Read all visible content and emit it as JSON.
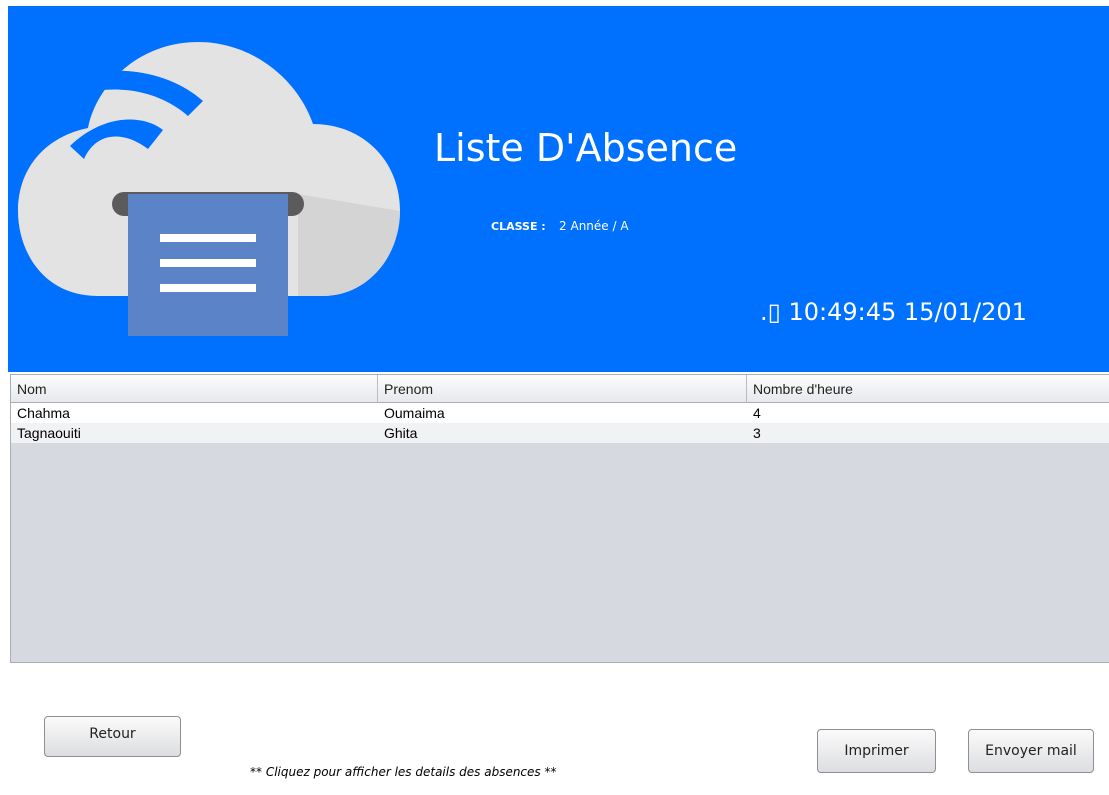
{
  "header": {
    "title": "Liste D'Absence",
    "classe_label": "CLASSE :",
    "classe_value": "2 Année / A",
    "clock": ".▯ 10:49:45 15/01/201"
  },
  "table": {
    "columns": [
      "Nom",
      "Prenom",
      "Nombre d'heure"
    ],
    "rows": [
      [
        "Chahma",
        "Oumaima",
        "4"
      ],
      [
        "Tagnaouiti",
        "Ghita",
        "3"
      ]
    ]
  },
  "buttons": {
    "retour": "Retour",
    "imprimer": "Imprimer",
    "envoyer_mail": "Envoyer mail"
  },
  "hint": "** Cliquez pour afficher les details des absences **",
  "colors": {
    "banner": "#0070ff",
    "cloud": "#e3e3e3",
    "document": "#5b84c8"
  },
  "icons": {
    "logo": "cloud-print-icon"
  }
}
